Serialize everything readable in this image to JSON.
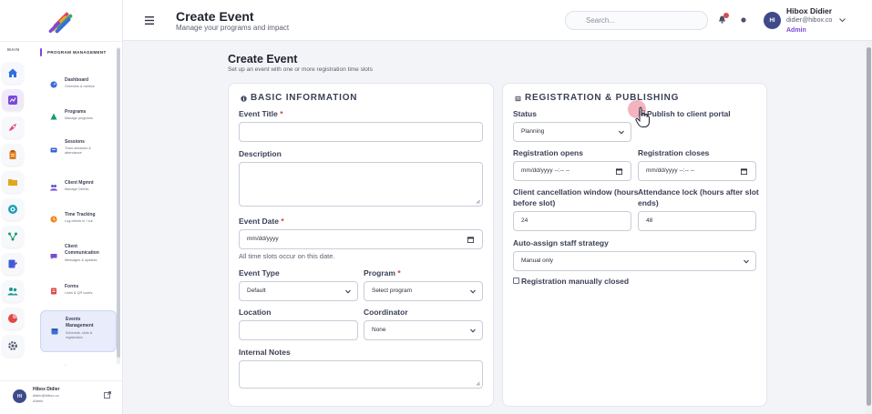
{
  "sidebar": {
    "main_label": "MAIN",
    "rail_icons": [
      "home-icon",
      "chart-icon",
      "rocket-icon",
      "clipboard-icon",
      "folder-icon",
      "target-icon",
      "network-icon",
      "document-edit-icon",
      "users-icon",
      "pie-chart-icon",
      "gear-icon"
    ],
    "section_title": "PROGRAM MANAGEMENT",
    "items": [
      {
        "name": "Dashboard",
        "desc": "Overview & metrics",
        "icon": "dashboard-icon"
      },
      {
        "name": "Programs",
        "desc": "Manage programs",
        "icon": "programs-icon"
      },
      {
        "name": "Sessions",
        "desc": "Track sessions & attendance",
        "icon": "sessions-icon"
      },
      {
        "name": "Client Mgmnt",
        "desc": "Manage Clients",
        "icon": "clients-icon"
      },
      {
        "name": "Time Tracking",
        "desc": "Log clients in / out",
        "icon": "clock-icon"
      },
      {
        "name": "Client Communication",
        "desc": "Messages & updates",
        "icon": "chat-icon"
      },
      {
        "name": "Forms",
        "desc": "Links & QR codes",
        "icon": "forms-icon"
      },
      {
        "name": "Events Management",
        "desc": "Schedule, slots & registration",
        "icon": "calendar-icon"
      }
    ],
    "cut_item": "...",
    "user": {
      "initials": "HI",
      "name": "Hibox Didier",
      "email": "didier@hibox.co",
      "role": "Admin"
    }
  },
  "header": {
    "title": "Create Event",
    "subtitle": "Manage your programs and impact",
    "search_placeholder": "Search...",
    "user": {
      "initials": "HI",
      "name": "Hibox Didier",
      "email": "didier@hibox.co",
      "role": "Admin"
    }
  },
  "page": {
    "title": "Create Event",
    "subtitle": "Set up an event with one or more registration time slots"
  },
  "basic": {
    "heading": "BASIC INFORMATION",
    "event_title_label": "Event Title",
    "description_label": "Description",
    "event_date_label": "Event Date",
    "event_date_value": "mm/dd/yyyy",
    "event_date_hint": "All time slots occur on this date.",
    "event_type_label": "Event Type",
    "event_type_value": "Default",
    "program_label": "Program",
    "program_value": "Select program",
    "location_label": "Location",
    "coordinator_label": "Coordinator",
    "coordinator_value": "None",
    "internal_notes_label": "Internal Notes",
    "required_mark": "*"
  },
  "registration": {
    "heading": "REGISTRATION & PUBLISHING",
    "status_label": "Status",
    "status_value": "Planning",
    "publish_label": "Publish to client portal",
    "reg_opens_label": "Registration opens",
    "reg_opens_value": "mm/dd/yyyy --:-- --",
    "reg_closes_label": "Registration closes",
    "reg_closes_value": "mm/dd/yyyy --:-- --",
    "cancel_window_label_1": "Client cancellation window (hours",
    "cancel_window_label_2": "before slot)",
    "cancel_window_value": "24",
    "attendance_lock_label_1": "Attendance lock (hours after slot",
    "attendance_lock_label_2": "ends)",
    "attendance_lock_value": "48",
    "auto_assign_label": "Auto-assign staff strategy",
    "auto_assign_value": "Manual only",
    "manual_closed_label": "Registration manually closed"
  },
  "colors": {
    "accent": "#7a4ad6",
    "brand_blue": "#3f4a8a",
    "required": "#d63a3a"
  }
}
